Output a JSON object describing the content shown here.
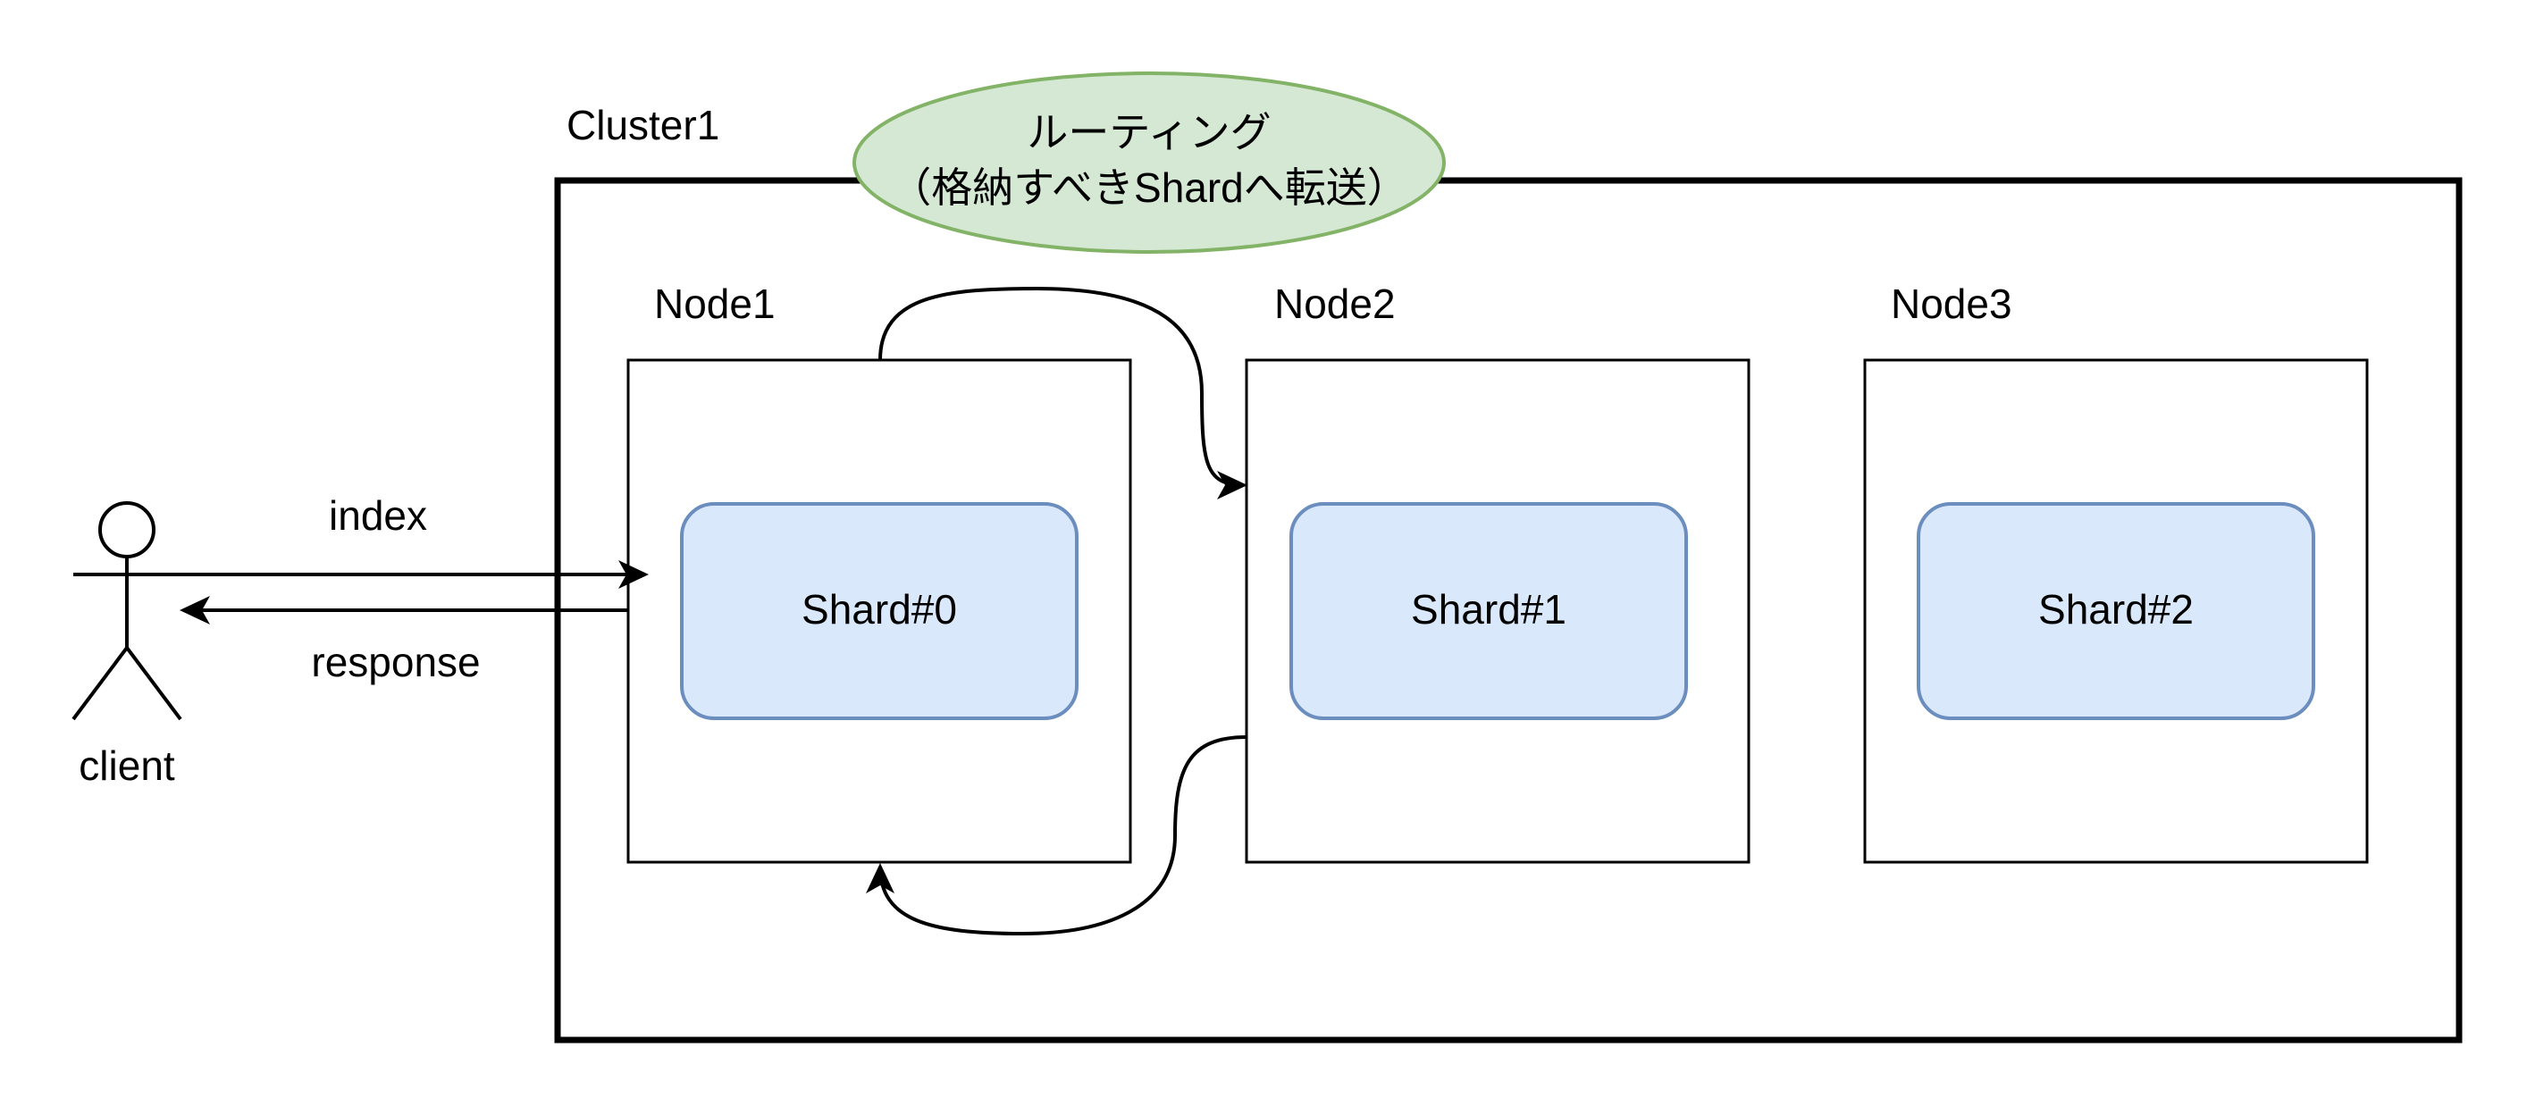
{
  "cluster": {
    "label": "Cluster1"
  },
  "routing": {
    "line1": "ルーティング",
    "line2": "（格納すべきShardへ転送）",
    "fill": "#d5e8d4",
    "stroke": "#82b366"
  },
  "nodes": [
    {
      "label": "Node1",
      "shard": "Shard#0"
    },
    {
      "label": "Node2",
      "shard": "Shard#1"
    },
    {
      "label": "Node3",
      "shard": "Shard#2"
    }
  ],
  "shard_style": {
    "fill": "#dae8fc",
    "stroke": "#6c8ebf"
  },
  "actor": {
    "label": "client",
    "icon": "person-icon"
  },
  "edges": {
    "request_label": "index",
    "response_label": "response"
  }
}
